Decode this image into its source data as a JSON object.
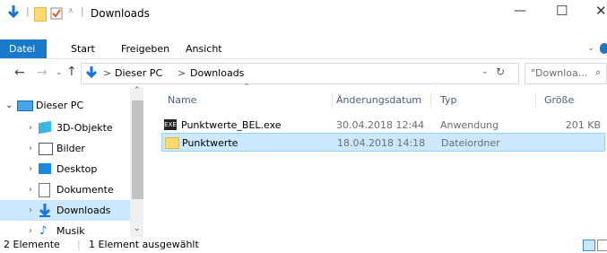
{
  "window": {
    "title": "Downloads",
    "minimize": "—",
    "maximize": "☐",
    "close": "✕"
  },
  "ribbon": {
    "tabs": [
      "Datei",
      "Start",
      "Freigeben",
      "Ansicht"
    ],
    "file_tab_color": "#1979ca"
  },
  "address": {
    "path": [
      "Dieser PC",
      "Downloads"
    ],
    "search_placeholder": "\"Downloa...",
    "separator": ">"
  },
  "nav": {
    "items": [
      {
        "label": "Dieser PC",
        "expanded": true,
        "icon": "pc-icon"
      },
      {
        "label": "3D-Objekte",
        "icon": "cube-icon"
      },
      {
        "label": "Bilder",
        "icon": "pictures-icon"
      },
      {
        "label": "Desktop",
        "icon": "desktop-icon"
      },
      {
        "label": "Dokumente",
        "icon": "documents-icon"
      },
      {
        "label": "Downloads",
        "icon": "downloads-icon",
        "selected": true
      },
      {
        "label": "Musik",
        "icon": "music-icon"
      }
    ]
  },
  "columns": {
    "name": "Name",
    "date": "Änderungsdatum",
    "type": "Typ",
    "size": "Größe"
  },
  "files": [
    {
      "name": "Punktwerte_BEL.exe",
      "date": "30.04.2018 12:44",
      "type": "Anwendung",
      "size": "201 KB",
      "icon": "exe-icon"
    },
    {
      "name": "Punktwerte",
      "date": "18.04.2018 14:18",
      "type": "Dateiordner",
      "size": "",
      "icon": "folder-icon",
      "selected": true
    }
  ],
  "status": {
    "count": "2 Elemente",
    "selection": "1 Element ausgewählt"
  }
}
